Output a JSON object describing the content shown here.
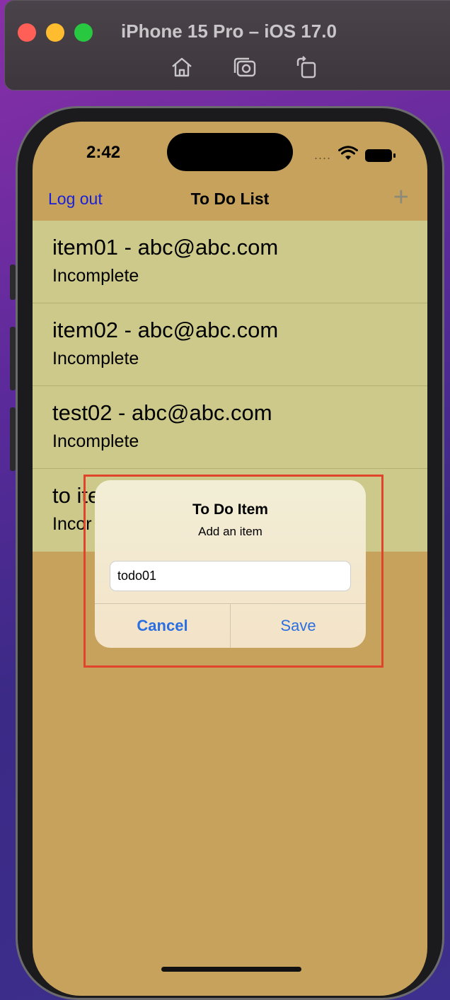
{
  "simulator": {
    "title": "iPhone 15 Pro – iOS 17.0",
    "icons": [
      "home-icon",
      "screenshot-icon",
      "rotate-icon"
    ]
  },
  "status_bar": {
    "time": "2:42",
    "signal": "....",
    "icons": [
      "wifi-icon",
      "battery-icon"
    ]
  },
  "nav": {
    "left_label": "Log out",
    "title": "To Do List",
    "right_icon": "plus-icon",
    "right_symbol": "+"
  },
  "list": {
    "items": [
      {
        "title": "item01 - abc@abc.com",
        "status": "Incomplete"
      },
      {
        "title": "item02 - abc@abc.com",
        "status": "Incomplete"
      },
      {
        "title": "test02 - abc@abc.com",
        "status": "Incomplete"
      },
      {
        "title": "to ite",
        "status": "Incor"
      }
    ]
  },
  "alert": {
    "title": "To Do Item",
    "message": "Add an item",
    "input_value": "todo01",
    "cancel_label": "Cancel",
    "save_label": "Save"
  },
  "colors": {
    "background": "#c6a25d",
    "list_background": "#cdc98a",
    "accent": "#2b6fe0",
    "nav_link": "#1a20d8",
    "highlight": "#e0452c"
  }
}
